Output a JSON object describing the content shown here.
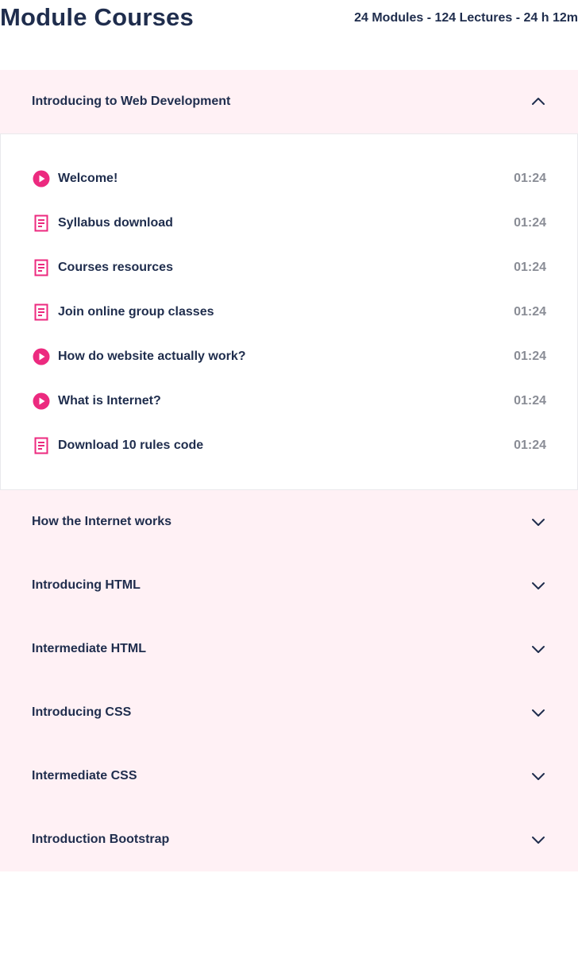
{
  "header": {
    "title": "Module Courses",
    "stats": "24 Modules - 124 Lectures - 24 h 12m"
  },
  "colors": {
    "accent": "#ec2a7f",
    "navy": "#1f2d4d",
    "module_bg": "#fff1f5",
    "duration_gray": "#8a8d96"
  },
  "expanded_module": {
    "title": "Introducing to Web Development",
    "chevron": "chevron-up-icon",
    "lessons": [
      {
        "icon": "play-icon",
        "title": "Welcome!",
        "duration": "01:24"
      },
      {
        "icon": "document-icon",
        "title": "Syllabus download",
        "duration": "01:24"
      },
      {
        "icon": "document-icon",
        "title": "Courses resources",
        "duration": "01:24"
      },
      {
        "icon": "document-icon",
        "title": "Join online group classes",
        "duration": "01:24"
      },
      {
        "icon": "play-icon",
        "title": "How do website actually work?",
        "duration": "01:24"
      },
      {
        "icon": "play-icon",
        "title": "What is Internet?",
        "duration": "01:24"
      },
      {
        "icon": "document-icon",
        "title": "Download 10 rules code",
        "duration": "01:24"
      }
    ]
  },
  "collapsed_modules": [
    {
      "title": "How the Internet works",
      "chevron": "chevron-down-icon"
    },
    {
      "title": "Introducing HTML",
      "chevron": "chevron-down-icon"
    },
    {
      "title": "Intermediate HTML",
      "chevron": "chevron-down-icon"
    },
    {
      "title": "Introducing CSS",
      "chevron": "chevron-down-icon"
    },
    {
      "title": "Intermediate CSS",
      "chevron": "chevron-down-icon"
    },
    {
      "title": "Introduction Bootstrap",
      "chevron": "chevron-down-icon"
    }
  ]
}
